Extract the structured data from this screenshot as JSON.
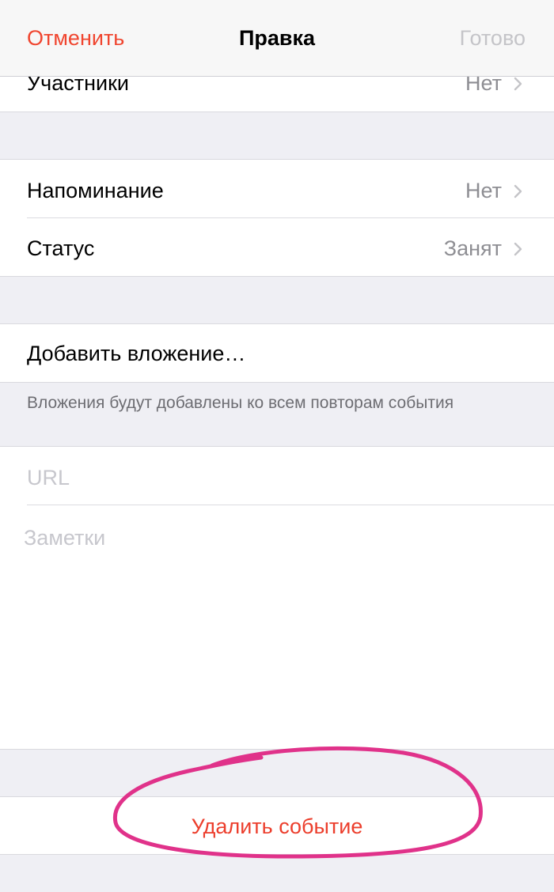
{
  "navbar": {
    "cancel_label": "Отменить",
    "title": "Правка",
    "done_label": "Готово"
  },
  "rows": {
    "participants": {
      "label": "Участники",
      "value": "Нет"
    },
    "reminder": {
      "label": "Напоминание",
      "value": "Нет"
    },
    "status": {
      "label": "Статус",
      "value": "Занят"
    },
    "attachment": {
      "label": "Добавить вложение…"
    }
  },
  "attachment_footnote": "Вложения будут добавлены ко всем повторам события",
  "url_field": {
    "placeholder": "URL"
  },
  "notes_field": {
    "placeholder": "Заметки"
  },
  "delete_event_label": "Удалить событие",
  "colors": {
    "accent": "#f0452f",
    "annotation": "#e0328a",
    "disabled": "#c4c4c8",
    "secondary_text": "#8e8e93"
  },
  "icons": {
    "disclosure": "chevron-right-icon",
    "annotation": "hand-drawn-circle"
  }
}
